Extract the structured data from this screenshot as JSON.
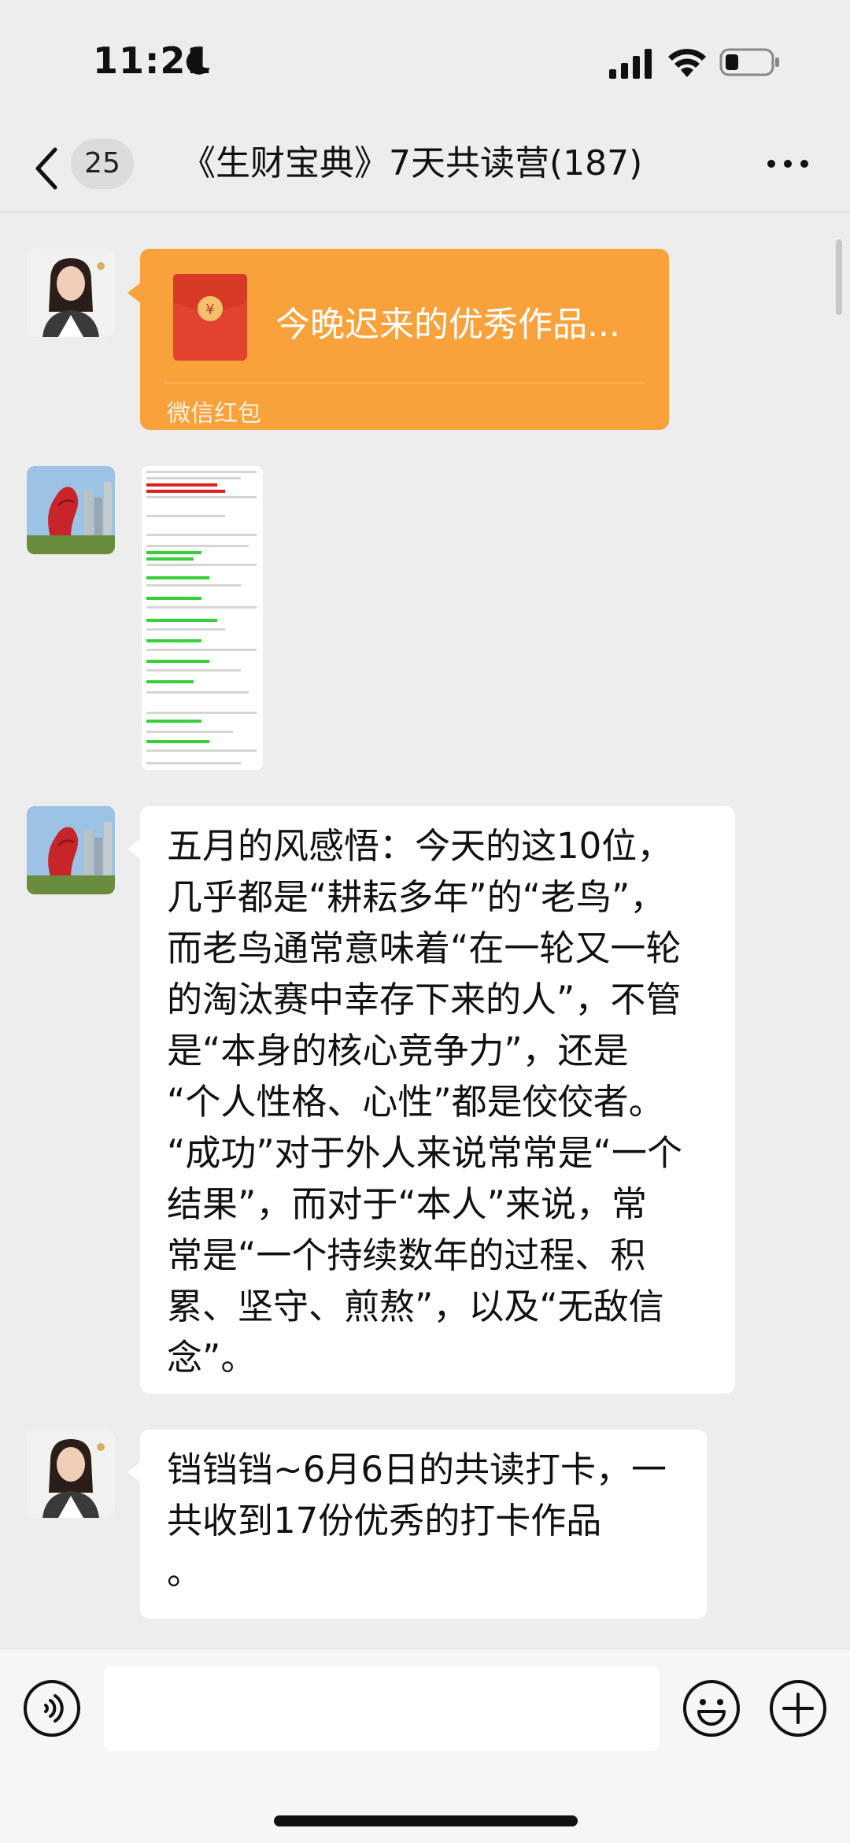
{
  "status_bar": {
    "time": "11:21"
  },
  "nav": {
    "unread_count": "25",
    "title": "《生财宝典》7天共读营(187)"
  },
  "messages": {
    "red_packet": {
      "title": "今晚迟来的优秀作品...",
      "label": "微信红包"
    },
    "text_1": {
      "lines": [
        "五月的风感悟：今天的这10位，",
        "几乎都是“耕耘多年”的“老鸟”，",
        "而老鸟通常意味着“在一轮又一轮",
        "的淘汰赛中幸存下来的人”，不管",
        "是“本身的核心竞争力”，还是",
        "“个人性格、心性”都是佼佼者。",
        "“成功”对于外人来说常常是“一个",
        "结果”，而对于“本人”来说，常",
        "常是“一个持续数年的过程、积",
        "累、坚守、煎熬”，以及“无敌信",
        "念”。"
      ]
    },
    "text_2": {
      "lines": [
        "铛铛铛~6月6日的共读打卡，一",
        "共收到17份优秀的打卡作品",
        "。"
      ]
    }
  },
  "colors": {
    "background": "#ededed",
    "red_packet": "#f9a13b",
    "bubble": "#ffffff"
  }
}
